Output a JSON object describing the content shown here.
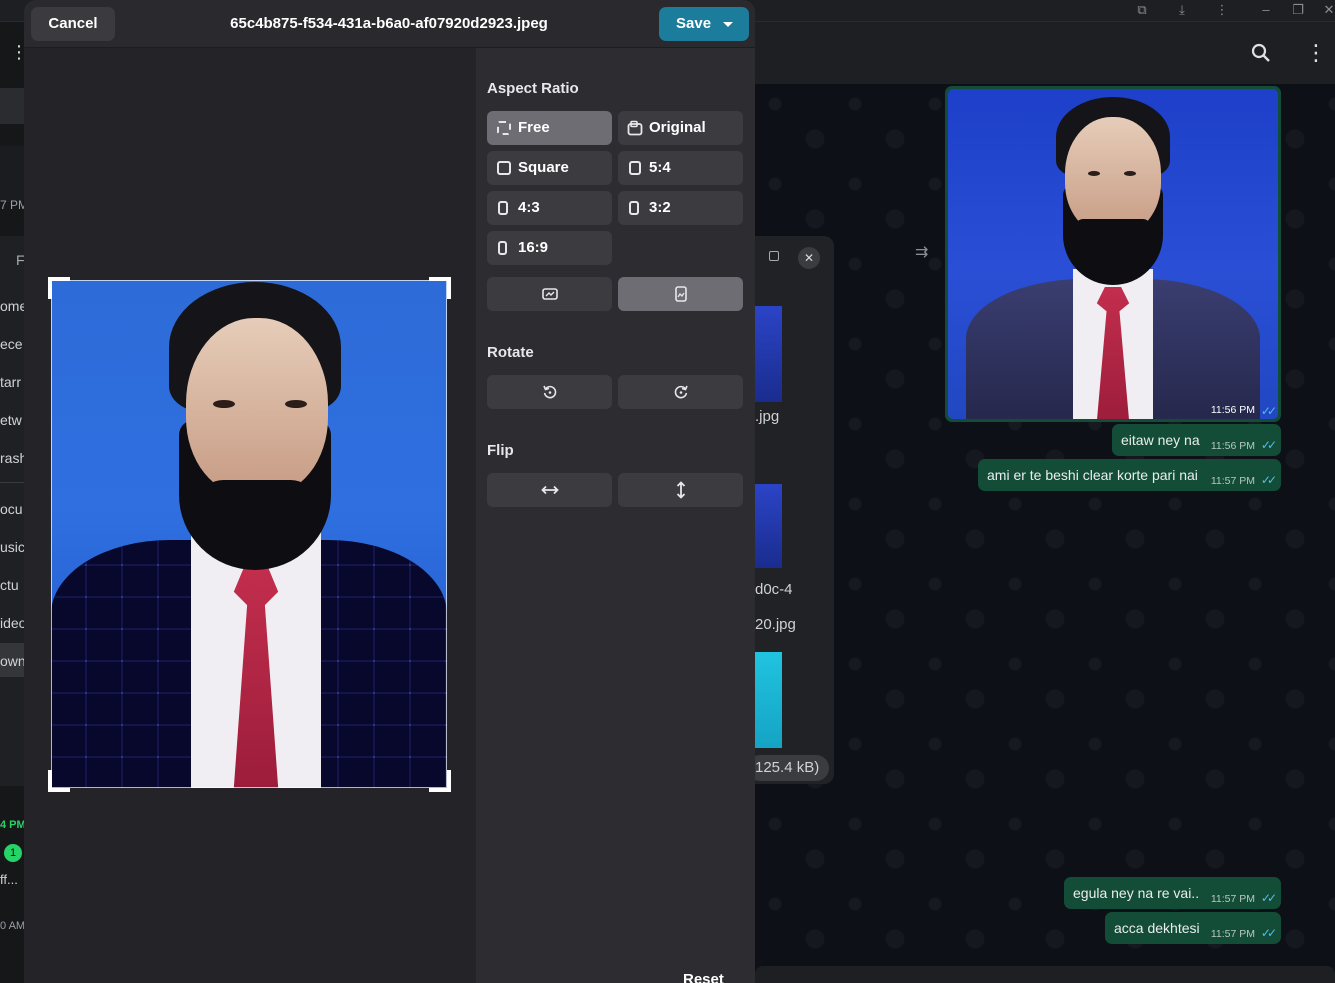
{
  "editor": {
    "cancel_label": "Cancel",
    "file_name": "65c4b875-f534-431a-b6a0-af07920d2923.jpeg",
    "save_label": "Save",
    "aspect_ratio_title": "Aspect Ratio",
    "aspect_options": [
      "Free",
      "Original",
      "Square",
      "5:4",
      "4:3",
      "3:2",
      "16:9"
    ],
    "selected_aspect": "Free",
    "orientation_icons": [
      "landscape-orientation-icon",
      "portrait-orientation-icon"
    ],
    "rotate_title": "Rotate",
    "rotate_icons": [
      "rotate-left-icon",
      "rotate-right-icon"
    ],
    "flip_title": "Flip",
    "flip_icons": [
      "flip-horizontal-icon",
      "flip-vertical-icon"
    ],
    "reset_label": "Reset"
  },
  "left_panel_fragments": [
    "7 PM",
    "F",
    "ome",
    "ece",
    "tarr",
    "etw",
    "rash",
    "ocu",
    "usic",
    "ctu",
    "ideo",
    "own",
    "4 PM",
    "1",
    "ff...",
    "0 AM"
  ],
  "file_list_fragments": [
    ".jpg",
    "d0c-4",
    "20.jpg",
    "125.4 kB)"
  ],
  "chat": {
    "messages": [
      {
        "text": "",
        "time": "11:56 PM",
        "type": "image"
      },
      {
        "text": "eitaw ney na",
        "time": "11:56 PM"
      },
      {
        "text": "ami er te beshi clear korte pari nai",
        "time": "11:57 PM"
      },
      {
        "text": "egula ney na re vai..",
        "time": "11:57 PM"
      },
      {
        "text": "acca dekhtesi",
        "time": "11:57 PM"
      }
    ]
  },
  "colors": {
    "accent": "#1c7c9c",
    "outgoing_bubble": "#144d37",
    "read_ticks": "#53bdeb"
  }
}
